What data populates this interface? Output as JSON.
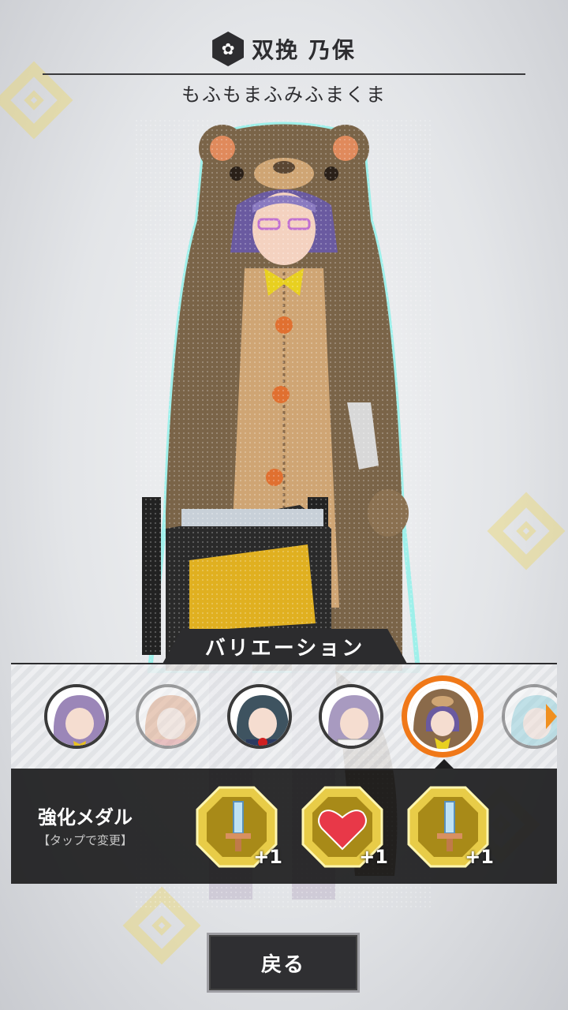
{
  "header": {
    "character_name": "双挽 乃保",
    "costume_name": "もふもまふみふまくま",
    "icon": "character-emblem-icon"
  },
  "variation": {
    "tab_label": "バリエーション",
    "portraits": [
      {
        "name": "variation-default",
        "hair": "#9b86b8",
        "selected": false,
        "dimmed": false
      },
      {
        "name": "variation-orange-hair",
        "hair": "#e0a07a",
        "selected": false,
        "dimmed": true
      },
      {
        "name": "variation-dark-hair",
        "hair": "#3e5360",
        "selected": false,
        "dimmed": false
      },
      {
        "name": "variation-white-top",
        "hair": "#a89ac0",
        "selected": false,
        "dimmed": false
      },
      {
        "name": "variation-bear",
        "hair": "#8a6a4a",
        "selected": true,
        "dimmed": false
      },
      {
        "name": "variation-cyan-hair",
        "hair": "#8ad0dc",
        "selected": false,
        "dimmed": true
      }
    ],
    "next_icon": "chevron-right-icon"
  },
  "medals": {
    "title": "強化メダル",
    "hint": "【タップで変更】",
    "items": [
      {
        "icon": "sword-icon",
        "bonus": "+1"
      },
      {
        "icon": "heart-icon",
        "bonus": "+1"
      },
      {
        "icon": "sword-icon",
        "bonus": "+1"
      }
    ]
  },
  "footer": {
    "back_label": "戻る"
  },
  "colors": {
    "accent": "#f07818",
    "panel": "#1d1d1f",
    "medal_gold": "#d6b42a",
    "glow": "#6ff0e8"
  }
}
